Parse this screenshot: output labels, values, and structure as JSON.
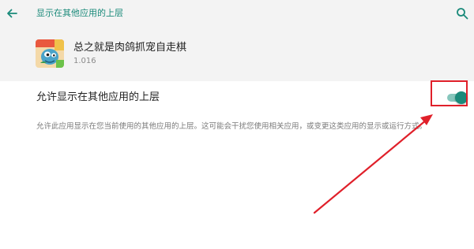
{
  "toolbar": {
    "title": "显示在其他应用的上层",
    "back_icon": "back-arrow-icon",
    "search_icon": "search-icon"
  },
  "app": {
    "name": "总之就是肉鸽抓宠自走棋",
    "version": "1.016",
    "icon": "app-icon"
  },
  "setting": {
    "label": "允许显示在其他应用的上层",
    "toggle_state": "on",
    "description": "允许此应用显示在您当前使用的其他应用的上层。这可能会干扰您使用相关应用，或变更这类应用的显示或运行方式。"
  },
  "colors": {
    "accent": "#1a8a7a",
    "toggle_track": "#86c6bc",
    "annotation": "#e0202a",
    "header_background": "#f3f3f3"
  }
}
